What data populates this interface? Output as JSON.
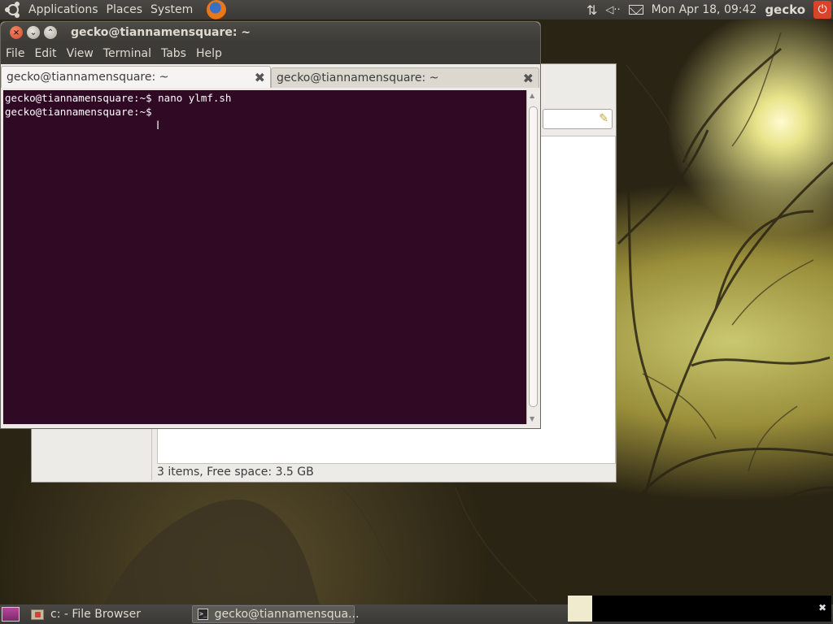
{
  "top_panel": {
    "menus": [
      "Applications",
      "Places",
      "System"
    ],
    "clock": "Mon Apr 18, 09:42",
    "user": "gecko",
    "icons": [
      "ubuntu-logo-icon",
      "firefox-icon",
      "network-icon",
      "volume-icon",
      "mail-icon",
      "power-icon"
    ]
  },
  "file_browser": {
    "status": "3 items, Free space: 3.5 GB"
  },
  "terminal": {
    "title": "gecko@tiannamensquare: ~",
    "menus": [
      "File",
      "Edit",
      "View",
      "Terminal",
      "Tabs",
      "Help"
    ],
    "tabs": [
      {
        "label": "gecko@tiannamensquare: ~"
      },
      {
        "label": "gecko@tiannamensquare: ~"
      }
    ],
    "lines": [
      "gecko@tiannamensquare:~$ nano ylmf.sh",
      "gecko@tiannamensquare:~$ "
    ],
    "background": "#300a24"
  },
  "bottom_panel": {
    "tasks": [
      {
        "label": "c: - File Browser"
      },
      {
        "label": "gecko@tiannamensqua..."
      }
    ]
  }
}
